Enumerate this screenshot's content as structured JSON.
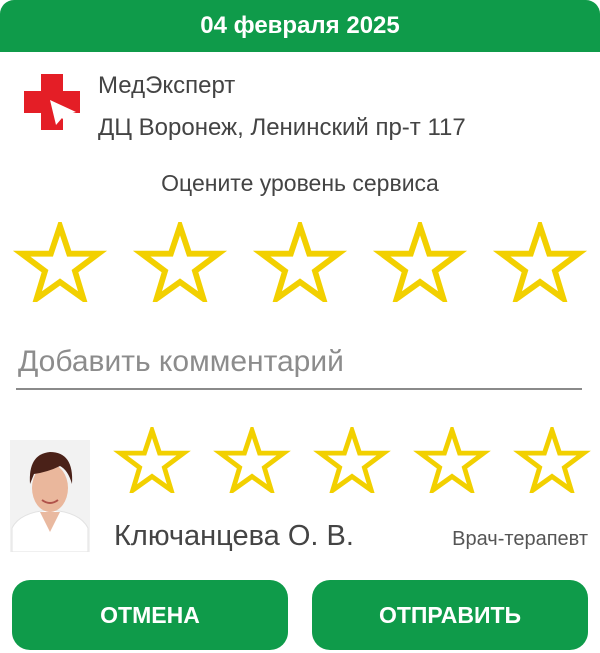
{
  "header": {
    "date": "04 февраля 2025"
  },
  "clinic": {
    "name": "МедЭксперт",
    "address": "ДЦ Воронеж, Ленинский пр-т 117",
    "logo_icon": "medical-cross-icon",
    "logo_color": "#e41e26"
  },
  "service_rating": {
    "label": "Оцените уровень сервиса",
    "max": 5,
    "value": 0,
    "star_color": "#f2d000"
  },
  "comment": {
    "placeholder": "Добавить комментарий",
    "value": ""
  },
  "doctor": {
    "name": "Ключанцева О. В.",
    "role": "Врач-терапевт",
    "rating": {
      "max": 5,
      "value": 0
    }
  },
  "actions": {
    "cancel_label": "ОТМЕНА",
    "submit_label": "ОТПРАВИТЬ"
  },
  "colors": {
    "accent": "#0f9b4a",
    "star": "#f2d000"
  }
}
